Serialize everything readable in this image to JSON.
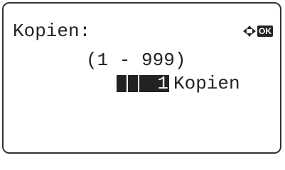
{
  "screen": {
    "title": "Kopien:",
    "range": "(1 - 999)",
    "quantity": {
      "value": "1",
      "unit": "Kopien"
    },
    "nav_hint": {
      "icon": "four-way-arrows-icon",
      "ok_label": "OK"
    }
  },
  "colors": {
    "ink": "#222222",
    "background": "#ffffff"
  }
}
